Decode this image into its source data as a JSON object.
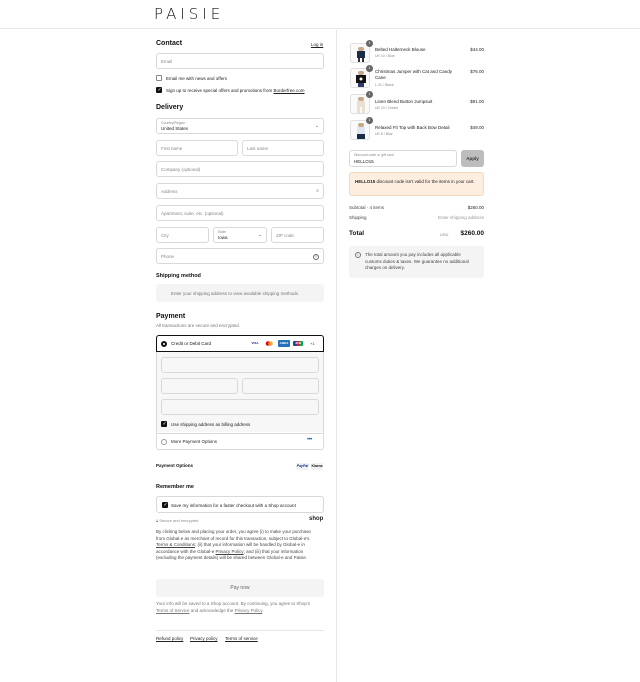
{
  "brand": {
    "logo": "PAISIE"
  },
  "contact": {
    "title": "Contact",
    "login": "Log in",
    "email_placeholder": "Email",
    "news_label": "Email me with news and offers",
    "sms_label_pre": "Sign up to receive special offers and promotions from ",
    "sms_link": "Borderfree.com"
  },
  "delivery": {
    "title": "Delivery",
    "country_label": "Country/Region",
    "country_value": "United States",
    "first_name": "First name",
    "last_name": "Last name",
    "company": "Company (optional)",
    "address": "Address",
    "apartment": "Apartment, suite, etc. (optional)",
    "city": "City",
    "state_label": "State",
    "state_value": "Iowa",
    "zip": "ZIP code",
    "phone": "Phone"
  },
  "shipping": {
    "title": "Shipping method",
    "note": "Enter your shipping address to view available shipping methods."
  },
  "payment": {
    "title": "Payment",
    "subtitle": "All transactions are secure and encrypted.",
    "card_option": "Credit or Debit Card",
    "more_cards": "+1",
    "billing_same": "Use shipping address as billing address",
    "more_options": "More Payment Options",
    "payment_options_label": "Payment Options",
    "paypal": "PayPal",
    "klarna": "Klarna"
  },
  "remember": {
    "title": "Remember me",
    "save_label": "Save my information for a faster checkout with a Shop account",
    "secure": "Secure and encrypted",
    "shop": "shop"
  },
  "legal": {
    "t1": "By clicking below and placing your order, you agree (i) to make your purchase",
    "t2": "from Global-e as merchant of record for this transaction, subject to Global-e's",
    "t3a": "Terms & Conditions",
    "t3b": "; (ii) that your information will be handled by Global-e in",
    "t4a": "accordance with the Global-e ",
    "t4b": "Privacy Policy",
    "t4c": "; and (iii) that your information",
    "t5": "(excluding the payment details) will be shared between Global-e and Paisie."
  },
  "pay_button": "Pay now",
  "shop_note": {
    "l1": "Your info will be saved to a Shop account. By continuing, you agree to Shop's",
    "l2a": "Terms of Service",
    "l2b": " and acknowledge the ",
    "l2c": "Privacy Policy",
    "l2d": "."
  },
  "footer": {
    "links": [
      "Refund policy",
      "Privacy policy",
      "Terms of service"
    ]
  },
  "order": {
    "items": [
      {
        "name": "Belted Halterneck Blouse",
        "variant": "UK 10 / Blue",
        "qty": "1",
        "price": "$44.00"
      },
      {
        "name": "Christmas Jumper with Cat and Candy Cane",
        "variant": "L-XL / Black",
        "qty": "1",
        "price": "$76.00"
      },
      {
        "name": "Linen Blend Button Jumpsuit",
        "variant": "UK 10 / Cream",
        "qty": "1",
        "price": "$91.00"
      },
      {
        "name": "Relaxed Fit Top with Back Bow Detail",
        "variant": "UK 8 / Blue",
        "qty": "1",
        "price": "$49.00"
      }
    ],
    "discount_label": "Discount code or gift card",
    "discount_value": "HELLO15",
    "apply": "Apply",
    "error_code": "HELLO15",
    "error_text": " discount code isn't valid for the items in your cart.",
    "subtotal_label": "Subtotal · 4 items",
    "subtotal_value": "$260.00",
    "shipping_label": "Shipping",
    "shipping_value": "Enter shipping address",
    "total_label": "Total",
    "currency": "USD",
    "total_value": "$260.00",
    "duties_note": "The total amount you pay includes all applicable customs duties & taxes. We guarantee no additional charges on delivery."
  }
}
